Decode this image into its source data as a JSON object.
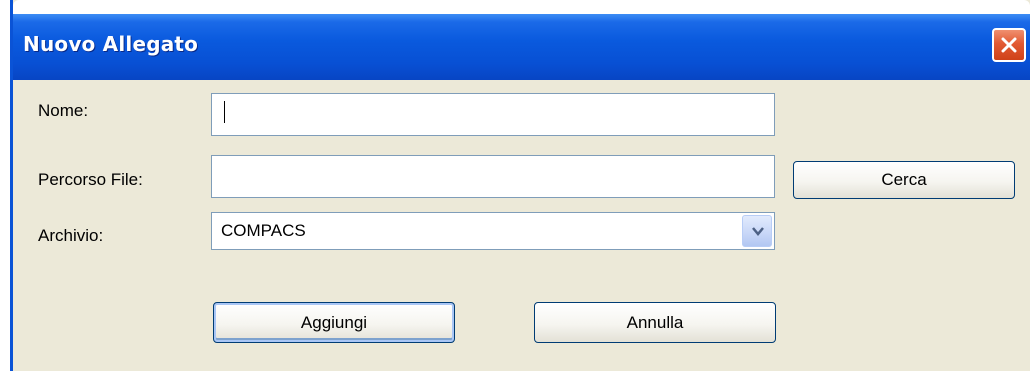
{
  "window": {
    "title": "Nuovo Allegato",
    "close_icon": "close-icon"
  },
  "form": {
    "nome": {
      "label": "Nome:",
      "value": ""
    },
    "percorso_file": {
      "label": "Percorso File:",
      "value": ""
    },
    "archivio": {
      "label": "Archivio:",
      "selected": "COMPACS",
      "dropdown_icon": "chevron-down-icon"
    }
  },
  "buttons": {
    "cerca": "Cerca",
    "aggiungi": "Aggiungi",
    "annulla": "Annulla"
  },
  "colors": {
    "titlebar": "#0850d4",
    "window_background": "#ece9d8",
    "close_button": "#e25a33",
    "textbox_border": "#7f9db9",
    "button_border": "#003c74"
  }
}
